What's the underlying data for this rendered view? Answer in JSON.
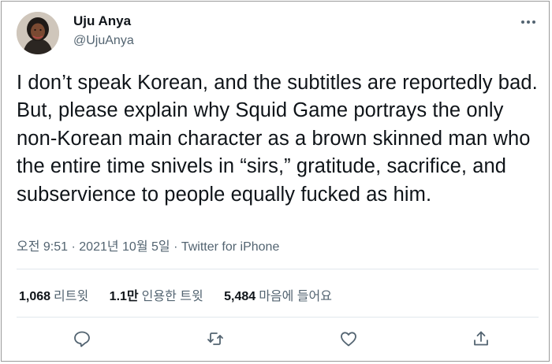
{
  "tweet": {
    "author": {
      "name": "Uju Anya",
      "handle": "@UjuAnya",
      "avatar_icon": "profile-photo"
    },
    "text": "I don’t speak Korean, and the subtitles are reportedly bad. But, please explain why Squid Game portrays the only non-Korean main character as a brown skinned man who the entire time snivels in “sirs,” gratitude, sacrifice, and subservience to people equally fucked as him.",
    "time": "오전 9:51",
    "date": "2021년 10월 5일",
    "separator": "·",
    "source": "Twitter for iPhone"
  },
  "stats": {
    "retweets_count": "1,068",
    "retweets_label": "리트윗",
    "quotes_count": "1.1만",
    "quotes_label": "인용한 트윗",
    "likes_count": "5,484",
    "likes_label": "마음에 들어요"
  },
  "actions": [
    "reply-icon",
    "retweet-icon",
    "like-icon",
    "share-icon"
  ],
  "colors": {
    "text": "#0f1419",
    "secondary": "#536471",
    "divider": "#e1e8ed"
  }
}
